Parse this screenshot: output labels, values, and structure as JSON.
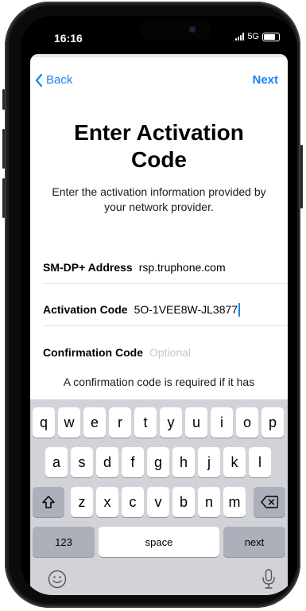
{
  "status": {
    "time": "16:16",
    "network": "5G"
  },
  "nav": {
    "back": "Back",
    "next": "Next"
  },
  "page": {
    "title": "Enter Activation Code",
    "subtitle": "Enter the activation information provided by your network provider."
  },
  "fields": {
    "smdp": {
      "label": "SM-DP+ Address",
      "value": "rsp.truphone.com"
    },
    "activation": {
      "label": "Activation Code",
      "value": "5O-1VEE8W-JL3877"
    },
    "confirmation": {
      "label": "Confirmation Code",
      "placeholder": "Optional"
    }
  },
  "note": "A confirmation code is required if it has",
  "keyboard": {
    "row1": [
      "q",
      "w",
      "e",
      "r",
      "t",
      "y",
      "u",
      "i",
      "o",
      "p"
    ],
    "row2": [
      "a",
      "s",
      "d",
      "f",
      "g",
      "h",
      "j",
      "k",
      "l"
    ],
    "row3": [
      "z",
      "x",
      "c",
      "v",
      "b",
      "n",
      "m"
    ],
    "numbers": "123",
    "space": "space",
    "next": "next"
  },
  "icons": {
    "back": "chevron-left-icon",
    "shift": "shift-icon",
    "delete": "delete-icon",
    "emoji": "emoji-icon",
    "mic": "microphone-icon",
    "signal": "signal-icon",
    "battery": "battery-icon"
  },
  "colors": {
    "accent": "#1a82f7",
    "keyboard_bg": "#d1d3d9",
    "dark_key": "#abb0ba"
  }
}
